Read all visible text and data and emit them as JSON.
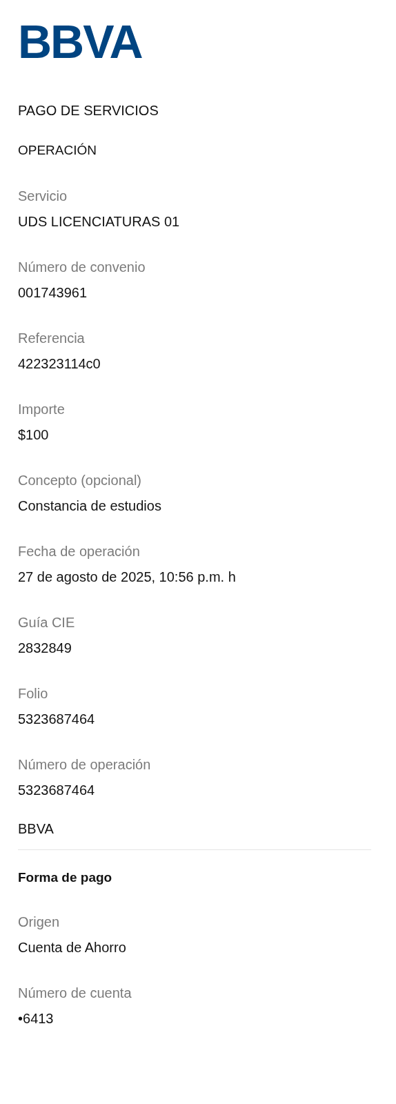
{
  "logo": "BBVA",
  "title": "PAGO DE SERVICIOS",
  "section": "OPERACIÓN",
  "fields": [
    {
      "label": "Servicio",
      "value": "UDS LICENCIATURAS 01"
    },
    {
      "label": "Número de convenio",
      "value": "001743961"
    },
    {
      "label": "Referencia",
      "value": "422323114c0"
    },
    {
      "label": "Importe",
      "value": "$100"
    },
    {
      "label": "Concepto (opcional)",
      "value": "Constancia de estudios"
    },
    {
      "label": "Fecha de operación",
      "value": "27 de agosto de 2025, 10:56 p.m. h"
    },
    {
      "label": "Guía CIE",
      "value": "2832849"
    },
    {
      "label": "Folio",
      "value": "5323687464"
    },
    {
      "label": "Número de operación",
      "value": "5323687464"
    }
  ],
  "bank": "BBVA",
  "payment": {
    "title": "Forma de pago",
    "fields": [
      {
        "label": "Origen",
        "value": "Cuenta de Ahorro"
      },
      {
        "label": "Número de cuenta",
        "value": "•6413"
      }
    ]
  }
}
